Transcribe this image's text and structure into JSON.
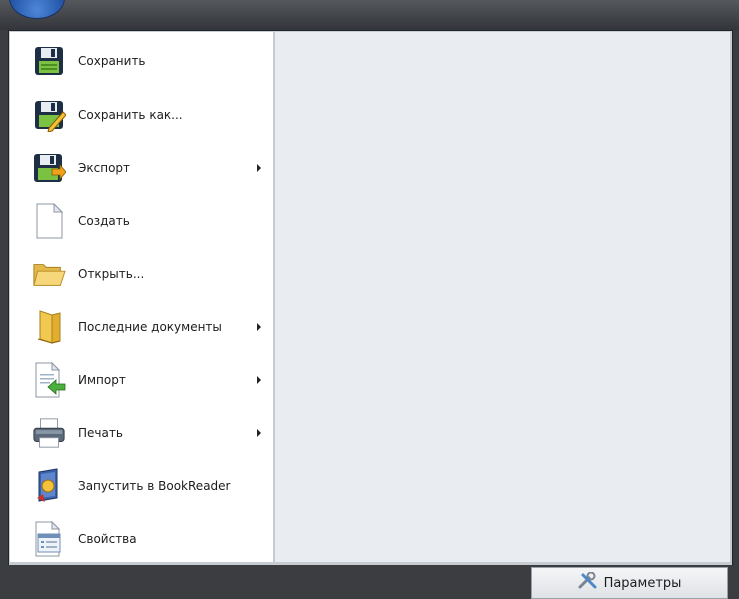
{
  "menu": {
    "items": [
      {
        "label": "Сохранить",
        "icon": "save-icon",
        "submenu": false
      },
      {
        "label": "Сохранить как...",
        "icon": "save-as-icon",
        "submenu": false
      },
      {
        "label": "Экспорт",
        "icon": "export-icon",
        "submenu": true
      },
      {
        "label": "Создать",
        "icon": "new-document-icon",
        "submenu": false
      },
      {
        "label": "Открыть...",
        "icon": "open-folder-icon",
        "submenu": false
      },
      {
        "label": "Последние документы",
        "icon": "recent-documents-icon",
        "submenu": true
      },
      {
        "label": "Импорт",
        "icon": "import-icon",
        "submenu": true
      },
      {
        "label": "Печать",
        "icon": "printer-icon",
        "submenu": true
      },
      {
        "label": "Запустить в BookReader",
        "icon": "bookreader-icon",
        "submenu": false
      },
      {
        "label": "Свойства",
        "icon": "properties-icon",
        "submenu": false
      }
    ]
  },
  "footer": {
    "params_label": "Параметры",
    "params_icon": "tools-icon"
  },
  "colors": {
    "orb": "#2a5fb2",
    "frame": "#3b3d41",
    "menu_bg": "#ffffff",
    "right_panel": "#e9ecf0"
  }
}
